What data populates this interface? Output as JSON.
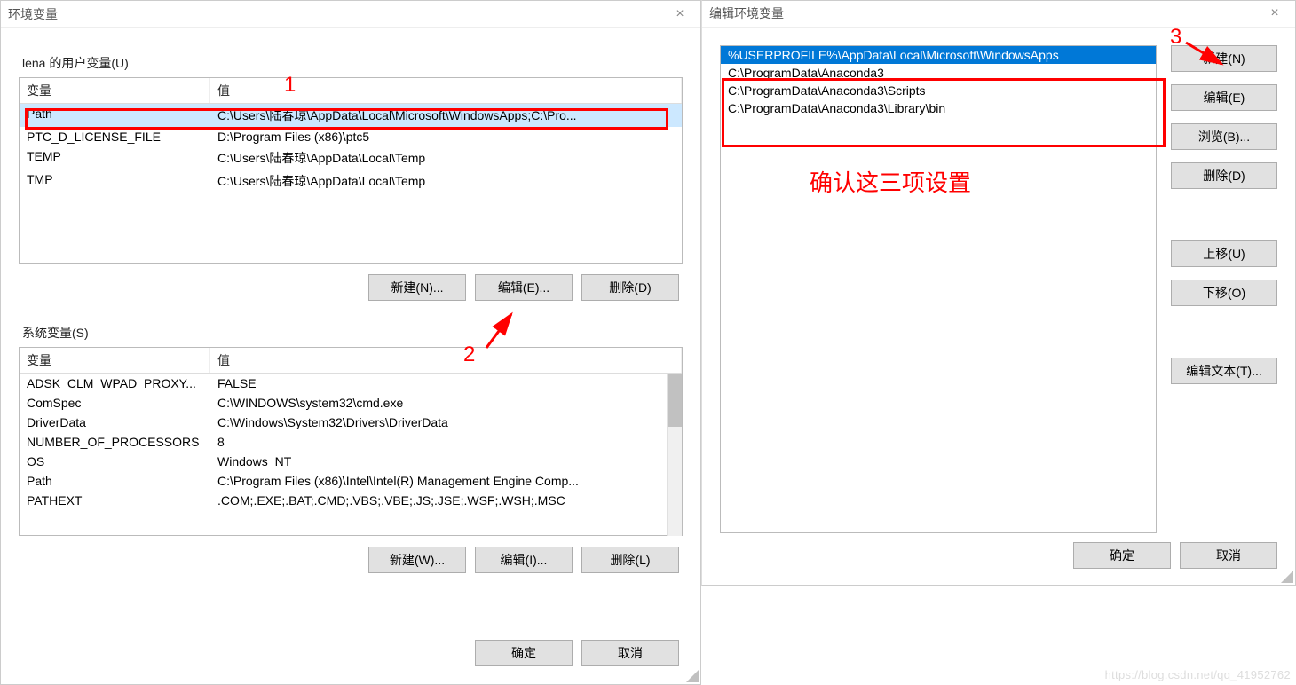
{
  "left": {
    "title": "环境变量",
    "user_label": "lena 的用户变量(U)",
    "headers": {
      "var": "变量",
      "val": "值"
    },
    "user_vars": [
      {
        "var": "Path",
        "val": "C:\\Users\\陆春琼\\AppData\\Local\\Microsoft\\WindowsApps;C:\\Pro..."
      },
      {
        "var": "PTC_D_LICENSE_FILE",
        "val": "D:\\Program Files (x86)\\ptc5"
      },
      {
        "var": "TEMP",
        "val": "C:\\Users\\陆春琼\\AppData\\Local\\Temp"
      },
      {
        "var": "TMP",
        "val": "C:\\Users\\陆春琼\\AppData\\Local\\Temp"
      }
    ],
    "user_btns": {
      "new": "新建(N)...",
      "edit": "编辑(E)...",
      "del": "删除(D)"
    },
    "sys_label": "系统变量(S)",
    "sys_vars": [
      {
        "var": "ADSK_CLM_WPAD_PROXY...",
        "val": "FALSE"
      },
      {
        "var": "ComSpec",
        "val": "C:\\WINDOWS\\system32\\cmd.exe"
      },
      {
        "var": "DriverData",
        "val": "C:\\Windows\\System32\\Drivers\\DriverData"
      },
      {
        "var": "NUMBER_OF_PROCESSORS",
        "val": "8"
      },
      {
        "var": "OS",
        "val": "Windows_NT"
      },
      {
        "var": "Path",
        "val": "C:\\Program Files (x86)\\Intel\\Intel(R) Management Engine Comp..."
      },
      {
        "var": "PATHEXT",
        "val": ".COM;.EXE;.BAT;.CMD;.VBS;.VBE;.JS;.JSE;.WSF;.WSH;.MSC"
      }
    ],
    "sys_btns": {
      "new": "新建(W)...",
      "edit": "编辑(I)...",
      "del": "删除(L)"
    },
    "footer": {
      "ok": "确定",
      "cancel": "取消"
    }
  },
  "right": {
    "title": "编辑环境变量",
    "items": [
      "%USERPROFILE%\\AppData\\Local\\Microsoft\\WindowsApps",
      "C:\\ProgramData\\Anaconda3",
      "C:\\ProgramData\\Anaconda3\\Scripts",
      "C:\\ProgramData\\Anaconda3\\Library\\bin"
    ],
    "btns": {
      "new": "新建(N)",
      "edit": "编辑(E)",
      "browse": "浏览(B)...",
      "del": "删除(D)",
      "up": "上移(U)",
      "down": "下移(O)",
      "edit_text": "编辑文本(T)..."
    },
    "footer": {
      "ok": "确定",
      "cancel": "取消"
    }
  },
  "anno": {
    "n1": "1",
    "n2": "2",
    "n3": "3",
    "confirm": "确认这三项设置"
  },
  "watermark": "https://blog.csdn.net/qq_41952762"
}
